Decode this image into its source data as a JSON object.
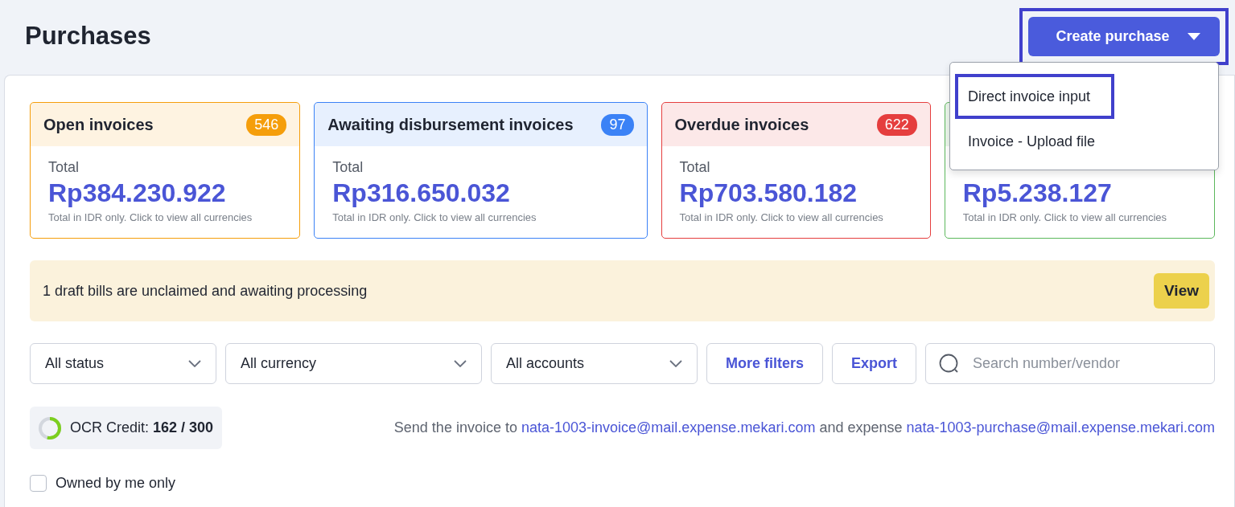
{
  "page": {
    "title": "Purchases"
  },
  "create_button": {
    "label": "Create purchase",
    "highlighted": true,
    "expanded": true
  },
  "create_menu": [
    {
      "label": "Direct invoice input",
      "highlighted": true
    },
    {
      "label": "Invoice - Upload file",
      "highlighted": false
    }
  ],
  "summary_cards": [
    {
      "title": "Open invoices",
      "count": "546",
      "color": "#f59e0b",
      "total_label": "Total",
      "amount": "Rp384.230.922",
      "note": "Total in IDR only. Click to view all currencies"
    },
    {
      "title": "Awaiting disbursement invoices",
      "count": "97",
      "color": "#3b82f6",
      "total_label": "Total",
      "amount": "Rp316.650.032",
      "note": "Total in IDR only. Click to view all currencies"
    },
    {
      "title": "Overdue invoices",
      "count": "622",
      "color": "#e53e3e",
      "total_label": "Total",
      "amount": "Rp703.580.182",
      "note": "Total in IDR only. Click to view all currencies"
    },
    {
      "color": "#5cb85c",
      "amount": "Rp5.238.127",
      "note": "Total in IDR only. Click to view all currencies"
    }
  ],
  "draft_notice": {
    "text": "1 draft bills are unclaimed and awaiting processing",
    "button": "View"
  },
  "filters": [
    {
      "kind": "select",
      "label": "All status"
    },
    {
      "kind": "select",
      "label": "All currency"
    },
    {
      "kind": "select",
      "label": "All accounts"
    },
    {
      "kind": "button",
      "label": "More filters"
    },
    {
      "kind": "button",
      "label": "Export"
    },
    {
      "kind": "search",
      "placeholder": "Search number/vendor"
    }
  ],
  "ocr_credit": {
    "label": "OCR Credit:",
    "value": "162 / 300",
    "level": 0.54
  },
  "email_info": {
    "prefix": "Send the invoice to",
    "invoice_email": "nata-1003-invoice@mail.expense.mekari.com",
    "middle": "and expense",
    "purchase_email": "nata-1003-purchase@mail.expense.mekari.com"
  },
  "owned_by_me": {
    "label": "Owned by me only",
    "checked": false
  }
}
